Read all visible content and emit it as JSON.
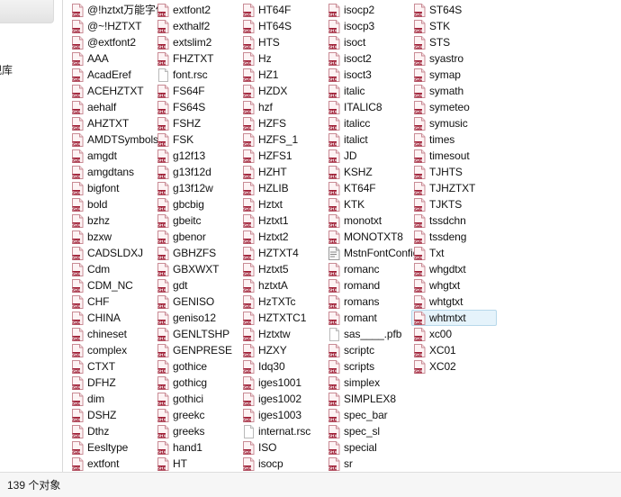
{
  "window": {
    "status_text": "139 个对象"
  },
  "nav_pane": {
    "items": [
      {
        "label": "影视库",
        "icon": "library-icon"
      }
    ]
  },
  "file_list": {
    "selected": "whtmtxt",
    "columns": [
      {
        "items": [
          {
            "name": "@!hztxt万能字体",
            "icon": "shx-file-icon"
          },
          {
            "name": "@~!HZTXT",
            "icon": "shx-file-icon"
          },
          {
            "name": "@extfont2",
            "icon": "shx-file-icon"
          },
          {
            "name": "AAA",
            "icon": "shx-file-icon"
          },
          {
            "name": "AcadEref",
            "icon": "shx-file-icon"
          },
          {
            "name": "ACEHZTXT",
            "icon": "shx-file-icon"
          },
          {
            "name": "aehalf",
            "icon": "shx-file-icon"
          },
          {
            "name": "AHZTXT",
            "icon": "shx-file-icon"
          },
          {
            "name": "AMDTSymbols",
            "icon": "shx-file-icon"
          },
          {
            "name": "amgdt",
            "icon": "shx-file-icon"
          },
          {
            "name": "amgdtans",
            "icon": "shx-file-icon"
          },
          {
            "name": "bigfont",
            "icon": "shx-file-icon"
          },
          {
            "name": "bold",
            "icon": "shx-file-icon"
          },
          {
            "name": "bzhz",
            "icon": "shx-file-icon"
          },
          {
            "name": "bzxw",
            "icon": "shx-file-icon"
          },
          {
            "name": "CADSLDXJ",
            "icon": "shx-file-icon"
          },
          {
            "name": "Cdm",
            "icon": "shx-file-icon"
          },
          {
            "name": "CDM_NC",
            "icon": "shx-file-icon"
          },
          {
            "name": "CHF",
            "icon": "shx-file-icon"
          },
          {
            "name": "CHINA",
            "icon": "shx-file-icon"
          },
          {
            "name": "chineset",
            "icon": "shx-file-icon"
          },
          {
            "name": "complex",
            "icon": "shx-file-icon"
          },
          {
            "name": "CTXT",
            "icon": "shx-file-icon"
          },
          {
            "name": "DFHZ",
            "icon": "shx-file-icon"
          },
          {
            "name": "dim",
            "icon": "shx-file-icon"
          },
          {
            "name": "DSHZ",
            "icon": "shx-file-icon"
          },
          {
            "name": "Dthz",
            "icon": "shx-file-icon"
          },
          {
            "name": "Eesltype",
            "icon": "shx-file-icon"
          },
          {
            "name": "extfont",
            "icon": "shx-file-icon"
          }
        ]
      },
      {
        "items": [
          {
            "name": "extfont2",
            "icon": "shx-file-icon"
          },
          {
            "name": "exthalf2",
            "icon": "shx-file-icon"
          },
          {
            "name": "extslim2",
            "icon": "shx-file-icon"
          },
          {
            "name": "FHZTXT",
            "icon": "shx-file-icon"
          },
          {
            "name": "font.rsc",
            "icon": "blank-file-icon"
          },
          {
            "name": "FS64F",
            "icon": "shx-file-icon"
          },
          {
            "name": "FS64S",
            "icon": "shx-file-icon"
          },
          {
            "name": "FSHZ",
            "icon": "shx-file-icon"
          },
          {
            "name": "FSK",
            "icon": "shx-file-icon"
          },
          {
            "name": "g12f13",
            "icon": "shx-file-icon"
          },
          {
            "name": "g13f12d",
            "icon": "shx-file-icon"
          },
          {
            "name": "g13f12w",
            "icon": "shx-file-icon"
          },
          {
            "name": "gbcbig",
            "icon": "shx-file-icon"
          },
          {
            "name": "gbeitc",
            "icon": "shx-file-icon"
          },
          {
            "name": "gbenor",
            "icon": "shx-file-icon"
          },
          {
            "name": "GBHZFS",
            "icon": "shx-file-icon"
          },
          {
            "name": "GBXWXT",
            "icon": "shx-file-icon"
          },
          {
            "name": "gdt",
            "icon": "shx-file-icon"
          },
          {
            "name": "GENISO",
            "icon": "shx-file-icon"
          },
          {
            "name": "geniso12",
            "icon": "shx-file-icon"
          },
          {
            "name": "GENLTSHP",
            "icon": "shx-file-icon"
          },
          {
            "name": "GENPRESE",
            "icon": "shx-file-icon"
          },
          {
            "name": "gothice",
            "icon": "shx-file-icon"
          },
          {
            "name": "gothicg",
            "icon": "shx-file-icon"
          },
          {
            "name": "gothici",
            "icon": "shx-file-icon"
          },
          {
            "name": "greekc",
            "icon": "shx-file-icon"
          },
          {
            "name": "greeks",
            "icon": "shx-file-icon"
          },
          {
            "name": "hand1",
            "icon": "shx-file-icon"
          },
          {
            "name": "HT",
            "icon": "shx-file-icon"
          }
        ]
      },
      {
        "items": [
          {
            "name": "HT64F",
            "icon": "shx-file-icon"
          },
          {
            "name": "HT64S",
            "icon": "shx-file-icon"
          },
          {
            "name": "HTS",
            "icon": "shx-file-icon"
          },
          {
            "name": "Hz",
            "icon": "shx-file-icon"
          },
          {
            "name": "HZ1",
            "icon": "shx-file-icon"
          },
          {
            "name": "HZDX",
            "icon": "shx-file-icon"
          },
          {
            "name": "hzf",
            "icon": "shx-file-icon"
          },
          {
            "name": "HZFS",
            "icon": "shx-file-icon"
          },
          {
            "name": "HZFS_1",
            "icon": "shx-file-icon"
          },
          {
            "name": "HZFS1",
            "icon": "shx-file-icon"
          },
          {
            "name": "HZHT",
            "icon": "shx-file-icon"
          },
          {
            "name": "HZLIB",
            "icon": "shx-file-icon"
          },
          {
            "name": "Hztxt",
            "icon": "shx-file-icon"
          },
          {
            "name": "Hztxt1",
            "icon": "shx-file-icon"
          },
          {
            "name": "Hztxt2",
            "icon": "shx-file-icon"
          },
          {
            "name": "HZTXT4",
            "icon": "shx-file-icon"
          },
          {
            "name": "Hztxt5",
            "icon": "shx-file-icon"
          },
          {
            "name": "hztxtA",
            "icon": "shx-file-icon"
          },
          {
            "name": "HzTXTc",
            "icon": "shx-file-icon"
          },
          {
            "name": "HZTXTC1",
            "icon": "shx-file-icon"
          },
          {
            "name": "Hztxtw",
            "icon": "shx-file-icon"
          },
          {
            "name": "HZXY",
            "icon": "shx-file-icon"
          },
          {
            "name": "Idq30",
            "icon": "shx-file-icon"
          },
          {
            "name": "iges1001",
            "icon": "shx-file-icon"
          },
          {
            "name": "iges1002",
            "icon": "shx-file-icon"
          },
          {
            "name": "iges1003",
            "icon": "shx-file-icon"
          },
          {
            "name": "internat.rsc",
            "icon": "blank-file-icon"
          },
          {
            "name": "ISO",
            "icon": "shx-file-icon"
          },
          {
            "name": "isocp",
            "icon": "shx-file-icon"
          }
        ]
      },
      {
        "items": [
          {
            "name": "isocp2",
            "icon": "shx-file-icon"
          },
          {
            "name": "isocp3",
            "icon": "shx-file-icon"
          },
          {
            "name": "isoct",
            "icon": "shx-file-icon"
          },
          {
            "name": "isoct2",
            "icon": "shx-file-icon"
          },
          {
            "name": "isoct3",
            "icon": "shx-file-icon"
          },
          {
            "name": "italic",
            "icon": "shx-file-icon"
          },
          {
            "name": "ITALIC8",
            "icon": "shx-file-icon"
          },
          {
            "name": "italicc",
            "icon": "shx-file-icon"
          },
          {
            "name": "italict",
            "icon": "shx-file-icon"
          },
          {
            "name": "JD",
            "icon": "shx-file-icon"
          },
          {
            "name": "KSHZ",
            "icon": "shx-file-icon"
          },
          {
            "name": "KT64F",
            "icon": "shx-file-icon"
          },
          {
            "name": "KTK",
            "icon": "shx-file-icon"
          },
          {
            "name": "monotxt",
            "icon": "shx-file-icon"
          },
          {
            "name": "MONOTXT8",
            "icon": "shx-file-icon"
          },
          {
            "name": "MstnFontConfig",
            "icon": "config-file-icon"
          },
          {
            "name": "romanc",
            "icon": "shx-file-icon"
          },
          {
            "name": "romand",
            "icon": "shx-file-icon"
          },
          {
            "name": "romans",
            "icon": "shx-file-icon"
          },
          {
            "name": "romant",
            "icon": "shx-file-icon"
          },
          {
            "name": "sas____.pfb",
            "icon": "blank-file-icon"
          },
          {
            "name": "scriptc",
            "icon": "shx-file-icon"
          },
          {
            "name": "scripts",
            "icon": "shx-file-icon"
          },
          {
            "name": "simplex",
            "icon": "shx-file-icon"
          },
          {
            "name": "SIMPLEX8",
            "icon": "shx-file-icon"
          },
          {
            "name": "spec_bar",
            "icon": "shx-file-icon"
          },
          {
            "name": "spec_sl",
            "icon": "shx-file-icon"
          },
          {
            "name": "special",
            "icon": "shx-file-icon"
          },
          {
            "name": "sr",
            "icon": "shx-file-icon"
          }
        ]
      },
      {
        "items": [
          {
            "name": "ST64S",
            "icon": "shx-file-icon"
          },
          {
            "name": "STK",
            "icon": "shx-file-icon"
          },
          {
            "name": "STS",
            "icon": "shx-file-icon"
          },
          {
            "name": "syastro",
            "icon": "shx-file-icon"
          },
          {
            "name": "symap",
            "icon": "shx-file-icon"
          },
          {
            "name": "symath",
            "icon": "shx-file-icon"
          },
          {
            "name": "symeteo",
            "icon": "shx-file-icon"
          },
          {
            "name": "symusic",
            "icon": "shx-file-icon"
          },
          {
            "name": "times",
            "icon": "shx-file-icon"
          },
          {
            "name": "timesout",
            "icon": "shx-file-icon"
          },
          {
            "name": "TJHTS",
            "icon": "shx-file-icon"
          },
          {
            "name": "TJHZTXT",
            "icon": "shx-file-icon"
          },
          {
            "name": "TJKTS",
            "icon": "shx-file-icon"
          },
          {
            "name": "tssdchn",
            "icon": "shx-file-icon"
          },
          {
            "name": "tssdeng",
            "icon": "shx-file-icon"
          },
          {
            "name": "Txt",
            "icon": "shx-file-icon"
          },
          {
            "name": "whgdtxt",
            "icon": "shx-file-icon"
          },
          {
            "name": "whgtxt",
            "icon": "shx-file-icon"
          },
          {
            "name": "whtgtxt",
            "icon": "shx-file-icon"
          },
          {
            "name": "whtmtxt",
            "icon": "shx-file-icon"
          },
          {
            "name": "xc00",
            "icon": "shx-file-icon"
          },
          {
            "name": "XC01",
            "icon": "shx-file-icon"
          },
          {
            "name": "XC02",
            "icon": "shx-file-icon"
          }
        ]
      }
    ]
  },
  "colors": {
    "icon_border": "#c98b95",
    "icon_fill": "#fdf3f4",
    "icon_badge": "#9e1b32",
    "selection_bg": "#e5f3fb",
    "selection_border": "#b7d8ea",
    "status_bg": "#f6f6f6"
  }
}
